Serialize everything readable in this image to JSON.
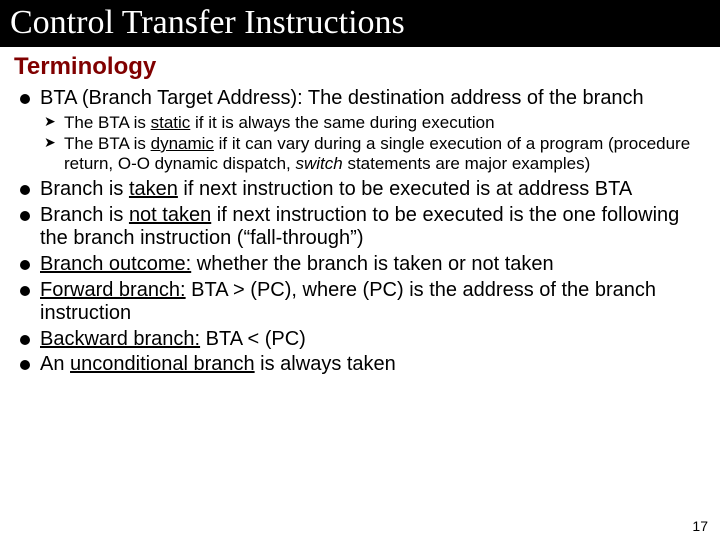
{
  "title": "Control Transfer Instructions",
  "section_heading": "Terminology",
  "page_number": "17",
  "items": [
    {
      "kind": "bullet",
      "segments": [
        {
          "t": "BTA (Branch Target Address): The destination address of the branch"
        }
      ],
      "sub": [
        {
          "segments": [
            {
              "t": "The BTA is "
            },
            {
              "t": "static",
              "u": true
            },
            {
              "t": " if it is always the same during execution"
            }
          ]
        },
        {
          "segments": [
            {
              "t": "The BTA is "
            },
            {
              "t": "dynamic",
              "u": true
            },
            {
              "t": " if it can vary during a single execution of a program (procedure return, O-O dynamic dispatch, "
            },
            {
              "t": "switch",
              "it": true
            },
            {
              "t": " statements are major examples)"
            }
          ]
        }
      ]
    },
    {
      "kind": "bullet",
      "segments": [
        {
          "t": "Branch is "
        },
        {
          "t": "taken",
          "u": true
        },
        {
          "t": " if next instruction to be executed is at address BTA"
        }
      ]
    },
    {
      "kind": "bullet",
      "segments": [
        {
          "t": "Branch is "
        },
        {
          "t": "not taken",
          "u": true
        },
        {
          "t": " if next instruction to be executed is the one following the branch instruction (“fall-through”)"
        }
      ]
    },
    {
      "kind": "bullet",
      "segments": [
        {
          "t": "Branch outcome:",
          "u": true
        },
        {
          "t": " whether the branch is taken or not taken"
        }
      ]
    },
    {
      "kind": "bullet",
      "segments": [
        {
          "t": "Forward branch:",
          "u": true
        },
        {
          "t": " BTA > (PC), where (PC) is the address of the branch instruction"
        }
      ]
    },
    {
      "kind": "bullet",
      "segments": [
        {
          "t": "Backward branch:",
          "u": true
        },
        {
          "t": " BTA < (PC)"
        }
      ]
    },
    {
      "kind": "bullet",
      "segments": [
        {
          "t": "An "
        },
        {
          "t": "unconditional branch",
          "u": true
        },
        {
          "t": " is always taken"
        }
      ]
    }
  ]
}
